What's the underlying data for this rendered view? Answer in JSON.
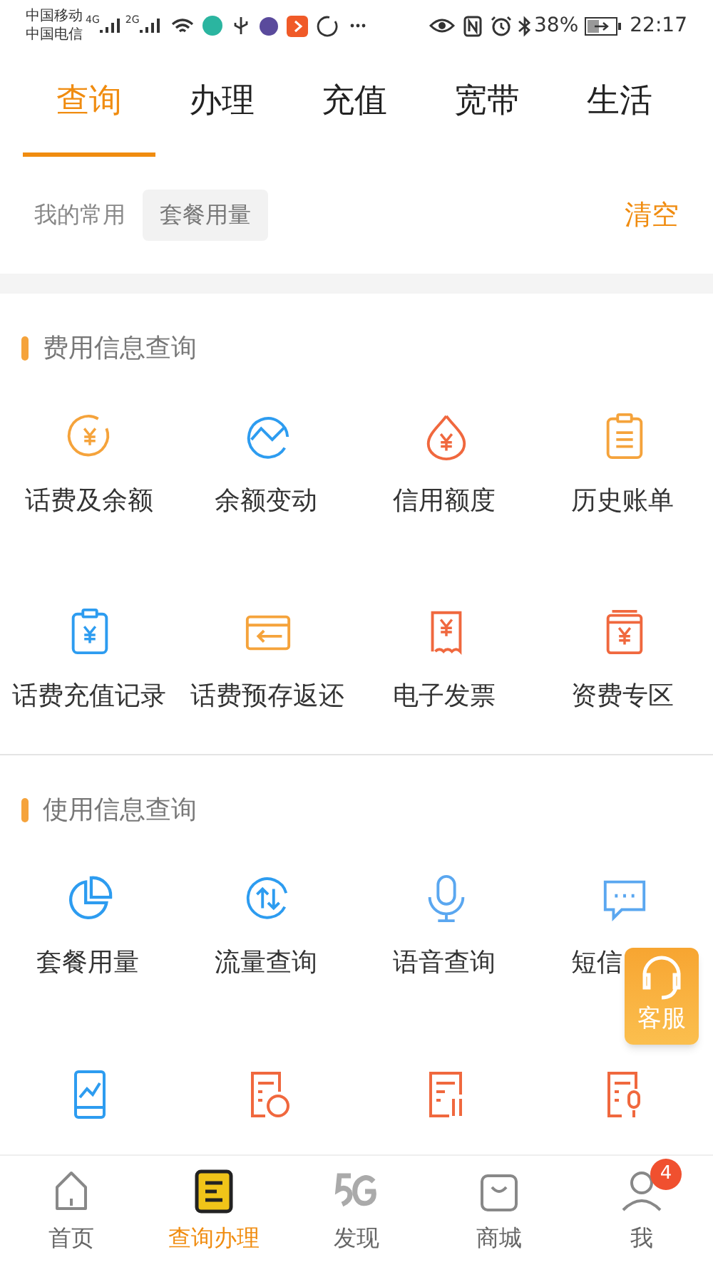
{
  "status_bar": {
    "carrier_1": "中国移动",
    "carrier_2": "中国电信",
    "network_1": "4G",
    "network_2": "2G",
    "battery": "38%",
    "time": "22:17"
  },
  "tabs": [
    {
      "label": "查询",
      "selected": true
    },
    {
      "label": "办理",
      "selected": false
    },
    {
      "label": "充值",
      "selected": false
    },
    {
      "label": "宽带",
      "selected": false
    },
    {
      "label": "生活",
      "selected": false
    }
  ],
  "favorites": {
    "label": "我的常用",
    "items": [
      "套餐用量"
    ],
    "clear": "清空"
  },
  "sections": [
    {
      "title": "费用信息查询",
      "items": [
        {
          "kind": "labeled",
          "label": "话费及余额"
        },
        {
          "kind": "labeled",
          "label": "余额变动"
        },
        {
          "kind": "labeled",
          "label": "信用额度"
        },
        {
          "kind": "labeled",
          "label": "历史账单"
        },
        {
          "kind": "labeled",
          "label": "话费充值记录"
        },
        {
          "kind": "labeled",
          "label": "话费预存返还"
        },
        {
          "kind": "labeled",
          "label": "电子发票"
        },
        {
          "kind": "labeled",
          "label": "资费专区"
        }
      ]
    },
    {
      "title": "使用信息查询",
      "items": [
        {
          "kind": "labeled",
          "label": "套餐用量"
        },
        {
          "kind": "labeled",
          "label": "流量查询"
        },
        {
          "kind": "labeled",
          "label": "语音查询"
        },
        {
          "kind": "labeled",
          "label": "短信"
        },
        {
          "kind": "icon_only"
        },
        {
          "kind": "icon_only"
        },
        {
          "kind": "icon_only"
        },
        {
          "kind": "icon_only"
        }
      ]
    }
  ],
  "service_button": {
    "label": "客服"
  },
  "bottom_nav": [
    {
      "label": "首页",
      "selected": false
    },
    {
      "label": "查询办理",
      "selected": true
    },
    {
      "label": "发现",
      "selected": false
    },
    {
      "label": "商城",
      "selected": false
    },
    {
      "label": "我",
      "selected": false,
      "badge": "4"
    }
  ]
}
